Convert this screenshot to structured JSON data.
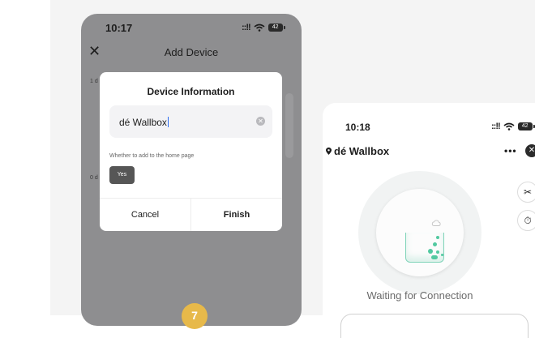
{
  "left_phone": {
    "time": "10:17",
    "signal": "::!!",
    "battery": "42",
    "title": "Add Device",
    "bg_label_1": "1 d",
    "bg_label_2": "0 d",
    "dialog": {
      "title": "Device Information",
      "name_value": "dé Wallbox",
      "hint": "Whether to add to the home page",
      "yes_label": "Yes",
      "cancel_label": "Cancel",
      "finish_label": "Finish"
    },
    "step_number": "7"
  },
  "right_phone": {
    "time": "10:18",
    "signal": "::!!",
    "battery": "42",
    "device_title": "dé Wallbox",
    "more_label": "•••",
    "status_text": "Waiting for Connection"
  },
  "colors": {
    "overlay_gray": "#8e8e90",
    "accent_green": "#52c9a0",
    "step_badge": "#e7b94a"
  }
}
